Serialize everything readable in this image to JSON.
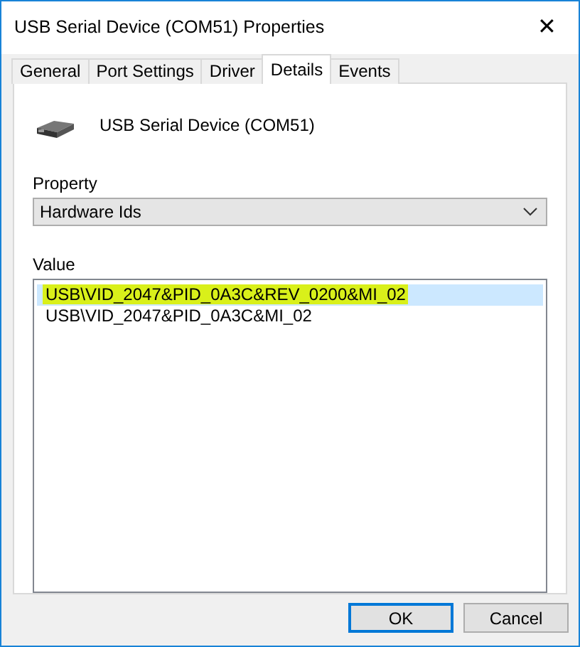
{
  "window": {
    "title": "USB Serial Device (COM51) Properties",
    "close": "✕"
  },
  "tabs": [
    {
      "label": "General",
      "selected": false
    },
    {
      "label": "Port Settings",
      "selected": false
    },
    {
      "label": "Driver",
      "selected": false
    },
    {
      "label": "Details",
      "selected": true
    },
    {
      "label": "Events",
      "selected": false
    }
  ],
  "device": {
    "name": "USB Serial Device (COM51)"
  },
  "property": {
    "label": "Property",
    "value": "Hardware Ids"
  },
  "value": {
    "label": "Value",
    "items": [
      {
        "text": "USB\\VID_2047&PID_0A3C&REV_0200&MI_02",
        "selected": true,
        "highlighted": true
      },
      {
        "text": "USB\\VID_2047&PID_0A3C&MI_02",
        "selected": false,
        "highlighted": false
      }
    ]
  },
  "buttons": [
    {
      "label": "OK",
      "default": true
    },
    {
      "label": "Cancel",
      "default": false
    }
  ]
}
